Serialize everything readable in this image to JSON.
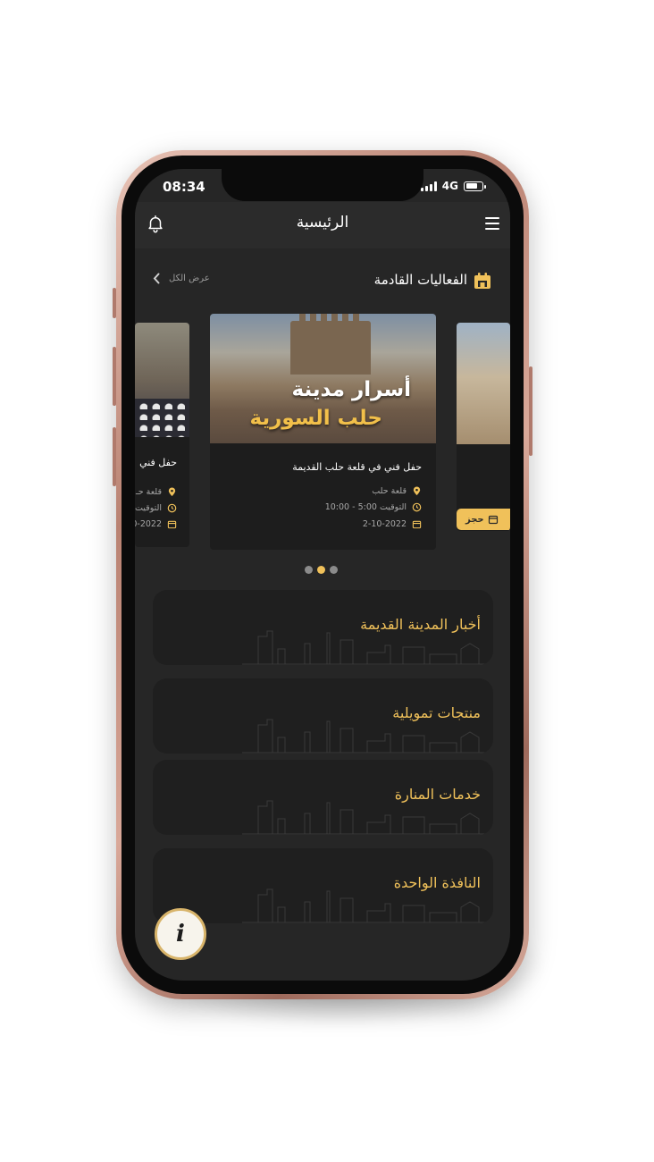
{
  "status": {
    "time": "08:34",
    "network": "4G"
  },
  "appbar": {
    "title": "الرئيسية",
    "bell_icon": "bell-icon",
    "menu_icon": "hamburger-icon"
  },
  "events": {
    "title": "الفعاليات القادمة",
    "view_all": "عرض الكل",
    "cards": [
      {
        "poster_line1": "أسرار مدينة",
        "poster_line2": "حلب السورية",
        "title": "حفل فني في قلعة حلب القديمة",
        "location": "قلعة حلب",
        "time": "التوقيت 5:00 - 10:00",
        "date": "2-10-2022"
      }
    ],
    "left_card": {
      "title": "حفل فني",
      "location": "قلعة حـ",
      "time": "التوقيت",
      "date": "0-2022"
    },
    "right_card": {
      "book_label": "حجز"
    },
    "pagination": {
      "count": 3,
      "active": 1
    }
  },
  "menu": [
    {
      "label": "أخبار المدينة القديمة"
    },
    {
      "label": "منتجات تمويلية"
    },
    {
      "label": "خدمات المنارة"
    },
    {
      "label": "النافذة الواحدة"
    }
  ],
  "fab": {
    "label": "i"
  },
  "colors": {
    "accent": "#f0c15a",
    "background": "#262626",
    "card": "#1f1f1f",
    "frame": "#c9958a"
  }
}
